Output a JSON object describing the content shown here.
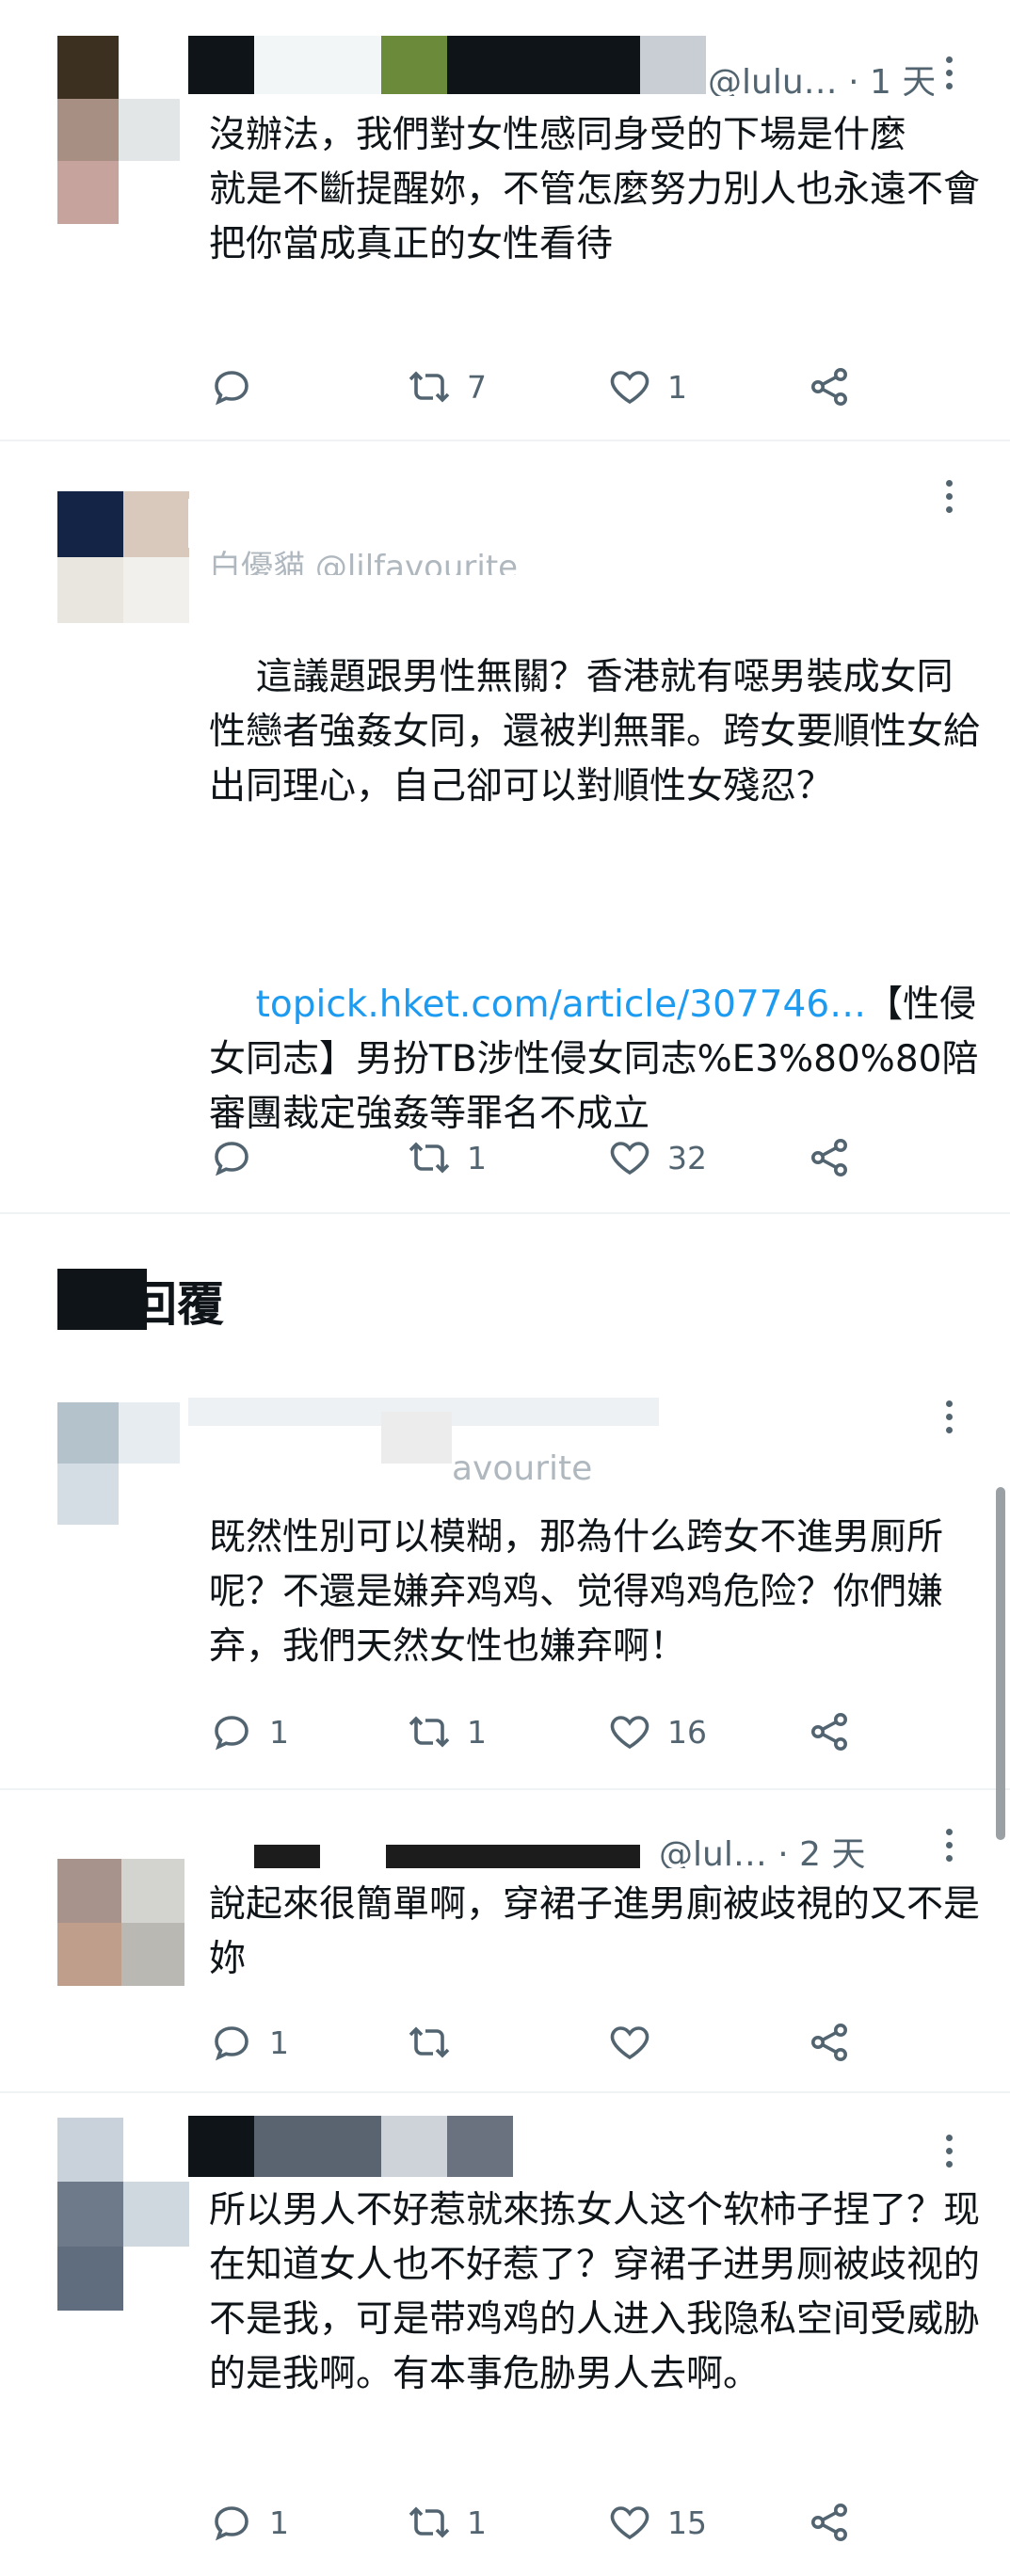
{
  "colors": {
    "text": "#0f1419",
    "secondary": "#536471",
    "link": "#1d9bf0",
    "divider": "#eff3f4"
  },
  "tweets": [
    {
      "handle": "@lulu…",
      "time": "· 1 天",
      "text": "沒辦法，我們對女性感同身受的下場是什麼\n就是不斷提醒妳，不管怎麼努力別人也永遠不會把你當成真正的女性看待",
      "retweets": "7",
      "likes": "1",
      "replies": ""
    },
    {
      "handle": "@lilfavourite",
      "display_name": "白優貓",
      "text": "這議題跟男性無關？香港就有噁男裝成女同性戀者強姦女同，還被判無罪。跨女要順性女給出同理心，自己卻可以對順性女殘忍？",
      "link": "topick.hket.com/article/307746…",
      "link_rest": "【性侵女同志】男扮TB涉性侵女同志%E3%80%80陪審團裁定強姦等罪名不成立",
      "retweets": "1",
      "likes": "32",
      "replies": ""
    }
  ],
  "section": {
    "title": "回覆"
  },
  "replies": [
    {
      "handle": "avourite",
      "text": "既然性別可以模糊，那為什么跨女不進男厠所呢？不還是嫌弃鸡鸡、觉得鸡鸡危险？你們嫌弃，我們天然女性也嫌弃啊！",
      "replies": "1",
      "retweets": "1",
      "likes": "16"
    },
    {
      "handle": "@lul…",
      "time": "· 2 天",
      "text": "說起來很簡單啊，穿裙子進男廁被歧視的又不是妳",
      "replies": "1",
      "retweets": "",
      "likes": ""
    },
    {
      "handle": "",
      "text": "所以男人不好惹就來拣女人这个软柿子捏了？现在知道女人也不好惹了？穿裙子进男厕被歧视的不是我，可是带鸡鸡的人进入我隐私空间受威胁的是我啊。有本事危胁男人去啊。",
      "replies": "1",
      "retweets": "1",
      "likes": "15"
    }
  ],
  "icons": {
    "reply": "reply-icon",
    "retweet": "retweet-icon",
    "like": "heart-icon",
    "share": "share-icon",
    "more": "more-icon"
  }
}
